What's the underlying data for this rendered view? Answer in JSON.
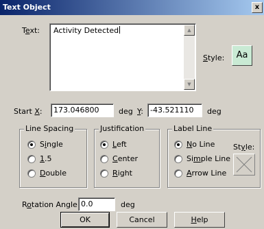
{
  "window": {
    "title": "Text Object",
    "close_glyph": "x"
  },
  "text": {
    "label_pre": "T",
    "label_u": "e",
    "label_post": "xt:",
    "value": "Activity Detected",
    "style_label_u": "S",
    "style_label_post": "tyle:",
    "style_button": "Aa"
  },
  "start": {
    "label_pre": "Start ",
    "label_u": "X",
    "label_post": ":",
    "x_value": "173.046800",
    "x_unit": "deg",
    "y_label_u": "Y",
    "y_label_post": ":",
    "y_value": "-43.521110",
    "y_unit": "deg"
  },
  "line_spacing": {
    "legend": "Line Spacing",
    "options": [
      {
        "u": "",
        "pre": "S",
        "mid": "i",
        "post": "ngle",
        "checked": true
      },
      {
        "pre": "",
        "mid": "1",
        "post": ".5",
        "checked": false
      },
      {
        "pre": "",
        "mid": "D",
        "post": "ouble",
        "checked": false
      }
    ]
  },
  "justification": {
    "legend": "Justification",
    "options": [
      {
        "pre": "",
        "mid": "L",
        "post": "eft",
        "checked": true
      },
      {
        "pre": "",
        "mid": "C",
        "post": "enter",
        "checked": false
      },
      {
        "pre": "",
        "mid": "R",
        "post": "ight",
        "checked": false
      }
    ]
  },
  "label_line": {
    "legend": "Label Line",
    "options": [
      {
        "pre": "",
        "mid": "N",
        "post": "o Line",
        "checked": true
      },
      {
        "pre": "Si",
        "mid": "m",
        "post": "ple Line",
        "checked": false
      },
      {
        "pre": "",
        "mid": "A",
        "post": "rrow Line",
        "checked": false
      }
    ],
    "style_label_pre": "St",
    "style_label_u": "y",
    "style_label_post": "le:"
  },
  "rotation": {
    "label_pre": "R",
    "label_u": "o",
    "label_post": "tation Angle:",
    "value": "0.0",
    "unit": "deg"
  },
  "buttons": {
    "ok": "OK",
    "cancel": "Cancel",
    "help_u": "H",
    "help_post": "elp"
  }
}
